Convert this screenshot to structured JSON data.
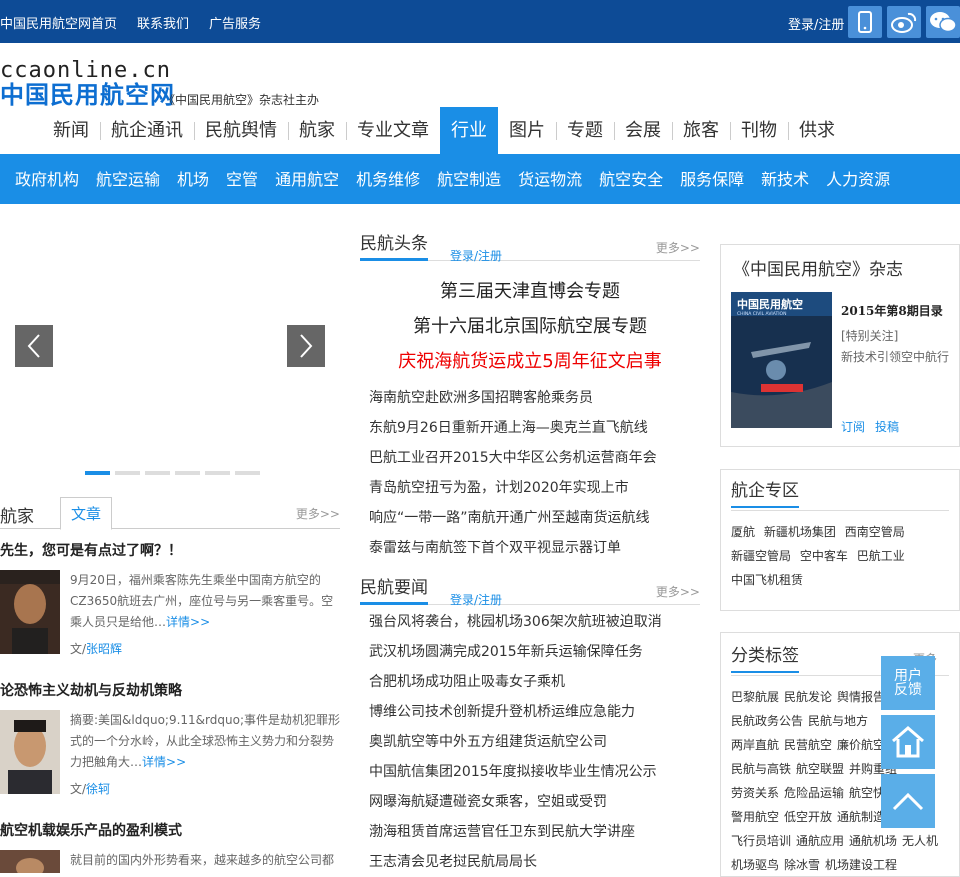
{
  "topbar": {
    "links": [
      "中国民用航空网首页",
      "联系我们",
      "广告服务"
    ],
    "login": "登录/注册",
    "icons": [
      "mobile-icon",
      "weibo-icon",
      "wechat-icon"
    ]
  },
  "logo": {
    "en": "ccaonline.cn",
    "cn": "中国民用航空网",
    "sub": "《中国民用航空》杂志社主办"
  },
  "main_nav": [
    "新闻",
    "航企通讯",
    "民航舆情",
    "航家",
    "专业文章",
    "行业",
    "图片",
    "专题",
    "会展",
    "旅客",
    "刊物",
    "供求"
  ],
  "main_nav_active": "行业",
  "sub_nav": [
    "政府机构",
    "航空运输",
    "机场",
    "空管",
    "通用航空",
    "机务维修",
    "航空制造",
    "货运物流",
    "航空安全",
    "服务保障",
    "新技术",
    "人力资源"
  ],
  "left": {
    "tab1": "航家",
    "tab2": "文章",
    "more": "更多>>",
    "articles": [
      {
        "title": "先生，您可是有点过了啊？！",
        "summary": "9月20日，福州乘客陈先生乘坐中国南方航空的CZ3650航班去广州，座位号与另一乘客重号。空乘人员只是给他…",
        "link": "详情>>",
        "author_label": "文/",
        "author": "张昭辉"
      },
      {
        "title": "论恐怖主义劫机与反劫机策略",
        "summary": "摘要:美国&ldquo;9.11&rdquo;事件是劫机犯罪形式的一个分水岭，从此全球恐怖主义势力和分裂势力把触角大…",
        "link": "详情>>",
        "author_label": "文/",
        "author": "徐轲"
      },
      {
        "title": "航空机载娱乐产品的盈利模式",
        "summary": "就目前的国内外形势看来，越来越多的航空公司都"
      }
    ]
  },
  "center": {
    "headlines": {
      "title": "民航头条",
      "reg": "登录/注册",
      "more": "更多>>",
      "features": [
        "第三届天津直博会专题",
        "第十六届北京国际航空展专题",
        "庆祝海航货运成立5周年征文启事"
      ],
      "items": [
        "海南航空赴欧洲多国招聘客舱乘务员",
        "东航9月26日重新开通上海—奥克兰直飞航线",
        "巴航工业召开2015大中华区公务机运营商年会",
        "青岛航空扭亏为盈，计划2020年实现上市",
        "响应“一带一路”南航开通广州至越南货运航线",
        "泰雷兹与南航签下首个双平视显示器订单"
      ]
    },
    "news": {
      "title": "民航要闻",
      "reg": "登录/注册",
      "more": "更多>>",
      "items": [
        "强台风将袭台，桃园机场306架次航班被迫取消",
        "武汉机场圆满完成2015年新兵运输保障任务",
        "合肥机场成功阻止吸毒女子乘机",
        "博维公司技术创新提升登机桥运维应急能力",
        "奥凯航空等中外五方组建货运航空公司",
        "中国航信集团2015年度拟接收毕业生情况公示",
        "网曝海航疑遭碰瓷女乘客，空姐或受罚",
        "渤海租赁首席运营官任卫东到民航大学讲座",
        "王志清会见老挝民航局局长"
      ]
    }
  },
  "right": {
    "magazine": {
      "title": "《中国民用航空》杂志",
      "issue": "2015年第8期目录",
      "tag": "[特别关注]",
      "desc": "新技术引领空中航行",
      "subscribe": "订阅",
      "submit": "投稿",
      "cover_title": "中国民用航空",
      "cover_en": "CHINA CIVIL AVIATION"
    },
    "airlines": {
      "title": "航企专区",
      "items": [
        "厦航",
        "新疆机场集团",
        "西南空管局",
        "新疆空管局",
        "空中客车",
        "巴航工业",
        "中国飞机租赁"
      ]
    },
    "tags": {
      "title": "分类标签",
      "more": "更多",
      "rows": [
        [
          "巴黎航展",
          "民航发论",
          "舆情报告"
        ],
        [
          "民航政务公告",
          "民航与地方"
        ],
        [
          "两岸直航",
          "民营航空",
          "廉价航空"
        ],
        [
          "民航与高铁",
          "航空联盟",
          "并购重组"
        ],
        [
          "劳资关系",
          "危险品运输",
          "航空快"
        ],
        [
          "警用航空",
          "低空开放",
          "通航制造"
        ],
        [
          "飞行员培训",
          "通航应用",
          "通航机场",
          "无人机"
        ],
        [
          "机场驱鸟",
          "除冰雪",
          "机场建设工程"
        ]
      ]
    }
  },
  "float": {
    "feedback": "用户反馈"
  }
}
